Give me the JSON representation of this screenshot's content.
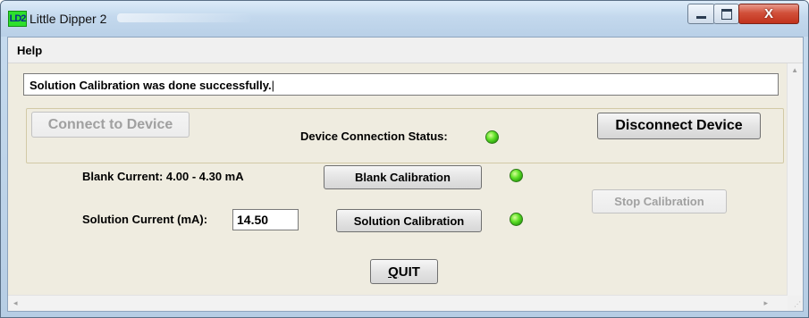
{
  "window": {
    "title": "Little Dipper 2",
    "icon_text": "LD2"
  },
  "titlebar_buttons": {
    "minimize": "minimize-icon",
    "maximize": "maximize-icon",
    "close": "close-icon",
    "close_glyph": "X"
  },
  "menu": {
    "items": [
      {
        "label": "Help"
      }
    ]
  },
  "status": {
    "message": "Solution Calibration was done successfully."
  },
  "connection": {
    "connect_label": "Connect to Device",
    "connect_enabled": false,
    "status_label": "Device Connection Status:",
    "status_color": "#33cc11",
    "disconnect_label": "Disconnect Device"
  },
  "calibration": {
    "blank_current_label": "Blank Current: 4.00 - 4.30 mA",
    "blank_button": "Blank Calibration",
    "blank_status_color": "#33cc11",
    "stop_button": "Stop Calibration",
    "stop_enabled": false,
    "solution_current_label": "Solution Current (mA):",
    "solution_current_value": "14.50",
    "solution_button": "Solution Calibration",
    "solution_status_color": "#33cc11"
  },
  "actions": {
    "quit_first": "Q",
    "quit_rest": "UIT"
  },
  "colors": {
    "form_background": "#efece0",
    "indicator_on": "#33cc11"
  }
}
